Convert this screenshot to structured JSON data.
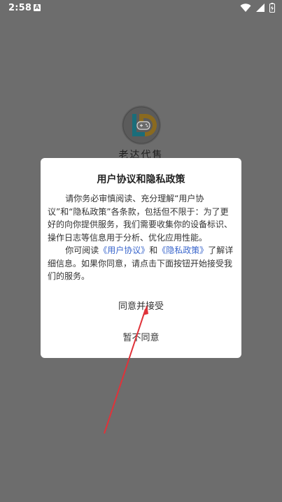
{
  "status_bar": {
    "time": "2:58",
    "notification_icon": "A"
  },
  "app": {
    "name": "老达代售",
    "logo_icon": "gamepad-logo-icon"
  },
  "dialog": {
    "title": "用户协议和隐私政策",
    "paragraph1": "请你务必审慎阅读、充分理解“用户协议”和“隐私政策”各条款，包括但不限于：为了更好的向你提供服务，我们需要收集你的设备标识、操作日志等信息用于分析、优化应用性能。",
    "paragraph2_prefix": "你可阅读",
    "link_user_agreement": "《用户协议》",
    "paragraph2_and": "和",
    "link_privacy_policy": "《隐私政策》",
    "paragraph2_suffix": "了解详细信息。如果你同意，请点击下面按钮开始接受我们的服务。",
    "agree_button": "同意并接受",
    "decline_button": "暂不同意"
  },
  "colors": {
    "overlay": "#6d6d6d",
    "link": "#3a66cc",
    "annotation_arrow": "#e0333a"
  }
}
